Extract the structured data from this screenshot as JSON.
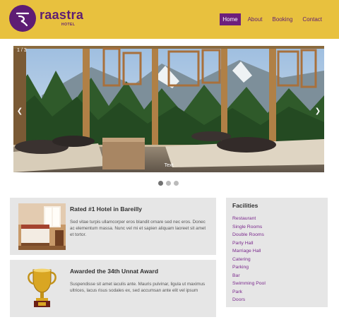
{
  "header": {
    "brand": "raastra",
    "brand_sub": "HOTEL",
    "nav": [
      {
        "label": "Home",
        "active": true
      },
      {
        "label": "About",
        "active": false
      },
      {
        "label": "Booking",
        "active": false
      },
      {
        "label": "Contact",
        "active": false
      }
    ]
  },
  "slider": {
    "counter": "1 / 3",
    "caption": "Text",
    "prev_icon": "chevron-left-icon",
    "next_icon": "chevron-right-icon",
    "dots": 3,
    "active_dot": 0
  },
  "features": [
    {
      "title": "Rated #1 Hotel in Bareilly",
      "text": "Sed vitae turpis ullamcorper eros blandit ornare sed nec eros. Donec ac elementum massa. Nunc vel mi et sapien aliquam laoreet sit amet et tortor.",
      "image": "hotel-room-image"
    },
    {
      "title": "Awarded the 34th Unnat Award",
      "text": "Suspendisse sit amet iaculis ante. Mauris pulvinar, ligula ut maximus ultrices, lacus risus sodales ex, sed accumsan ante elit vel ipsum",
      "image": "trophy-image"
    }
  ],
  "facilities": {
    "title": "Facilities",
    "items": [
      "Restaurant",
      "Single Rooms",
      "Double Rooms",
      "Party Hall",
      "Marriage Hall",
      "Catering",
      "Parking",
      "Bar",
      "Swimming Pool",
      "Park",
      "Doors"
    ]
  },
  "colors": {
    "header_bg": "#e8c13e",
    "brand_purple": "#5e1d74",
    "link_purple": "#7b2a8d",
    "card_bg": "#e6e6e6"
  }
}
